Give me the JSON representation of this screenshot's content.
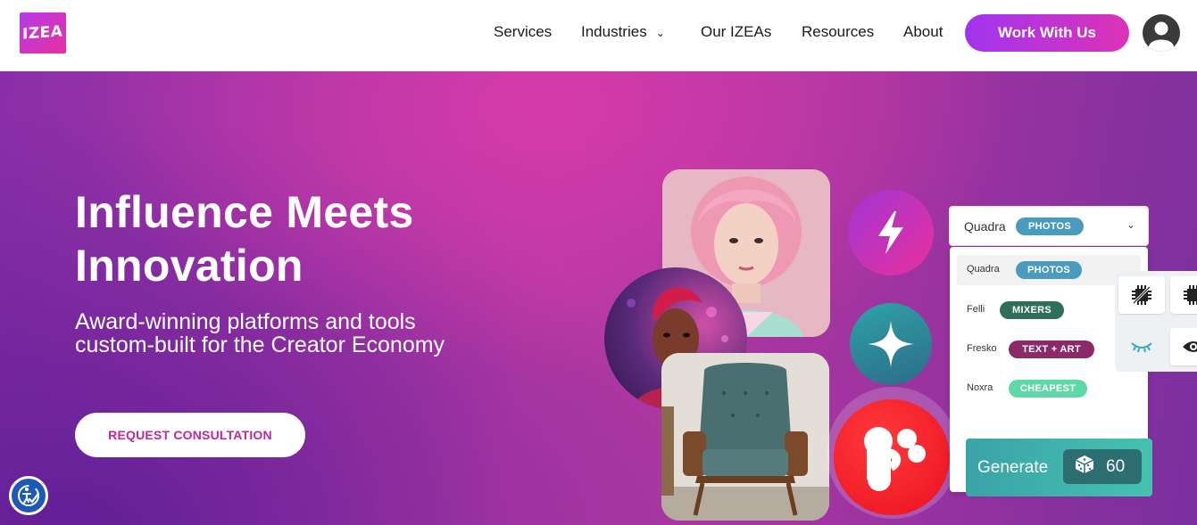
{
  "header": {
    "logo_text": "IZEA",
    "nav": [
      {
        "label": "Services"
      },
      {
        "label": "Industries",
        "has_dropdown": true
      },
      {
        "label": "Our IZEAs"
      },
      {
        "label": "Resources"
      },
      {
        "label": "About"
      }
    ],
    "cta_label": "Work With Us"
  },
  "hero": {
    "title": "Influence Meets Innovation",
    "subtitle": "Award-winning platforms and tools custom-built for the Creator Economy",
    "button_label": "REQUEST CONSULTATION"
  },
  "model_select": {
    "selected_name": "Quadra",
    "selected_tag": "PHOTOS",
    "options": [
      {
        "name": "Quadra",
        "tag": "PHOTOS",
        "tag_color": "#4a9bbd"
      },
      {
        "name": "Felli",
        "tag": "MIXERS",
        "tag_color": "#2f6e5a"
      },
      {
        "name": "Fresko",
        "tag": "TEXT + ART",
        "tag_color": "#8a2a6a"
      },
      {
        "name": "Noxra",
        "tag": "CHEAPEST",
        "tag_color": "#5fd8a8"
      }
    ]
  },
  "generate": {
    "label": "Generate",
    "count": "60"
  },
  "colors": {
    "brand_purple": "#a134f0",
    "brand_pink": "#dc33b6",
    "consult_text": "#c0279f"
  }
}
